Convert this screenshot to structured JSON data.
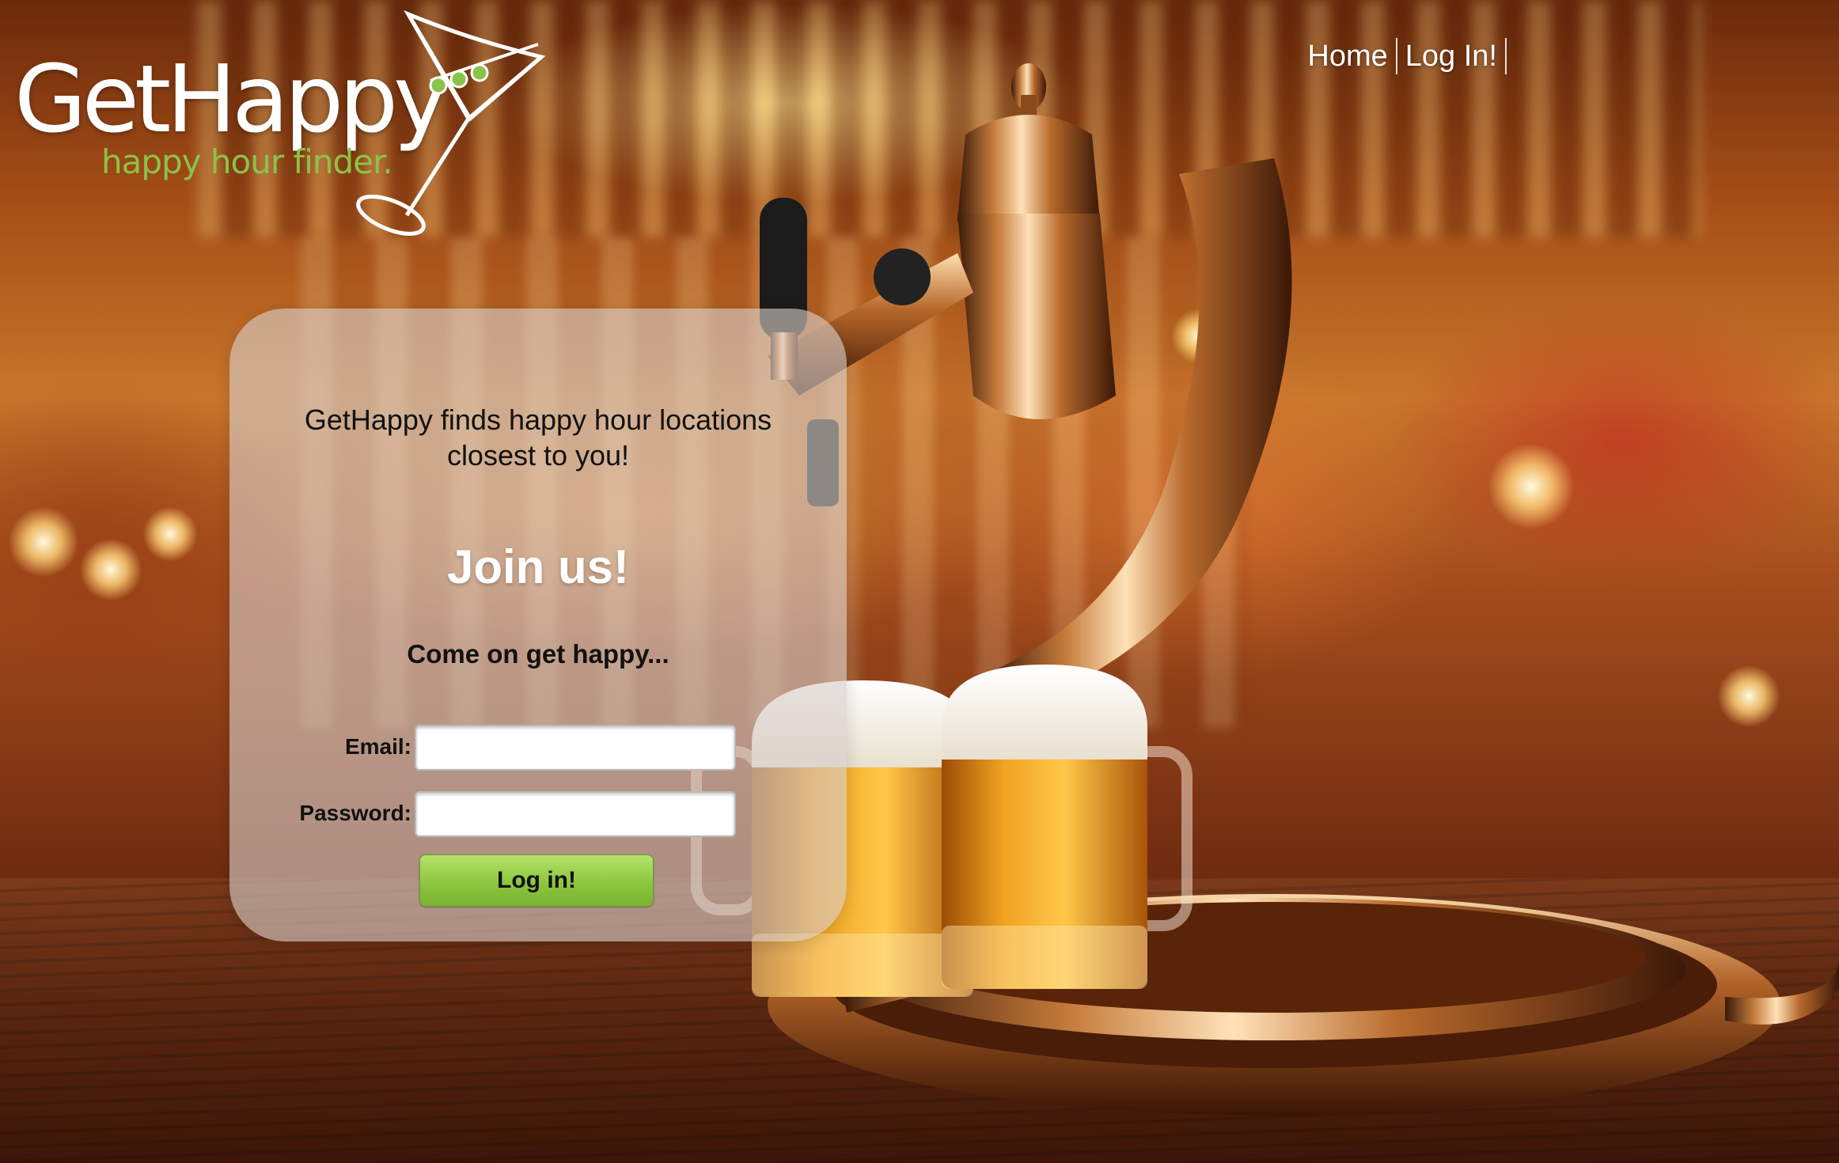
{
  "brand": {
    "name": "GetHappy",
    "tagline": "happy hour finder.",
    "tagline_color": "#8bc34a"
  },
  "nav": {
    "items": [
      {
        "label": "Home"
      },
      {
        "label": "Log In!"
      }
    ]
  },
  "card": {
    "intro": "GetHappy finds happy hour locations closest to you!",
    "heading": "Join us!",
    "subheading": "Come on get happy...",
    "email_label": "Email:",
    "email_value": "",
    "password_label": "Password:",
    "password_value": "",
    "submit_label": "Log in!",
    "button_color": "#8cc63f"
  },
  "icons": {
    "logo_glass": "martini-glass-icon",
    "illustration": "beer-tap-with-mugs"
  }
}
